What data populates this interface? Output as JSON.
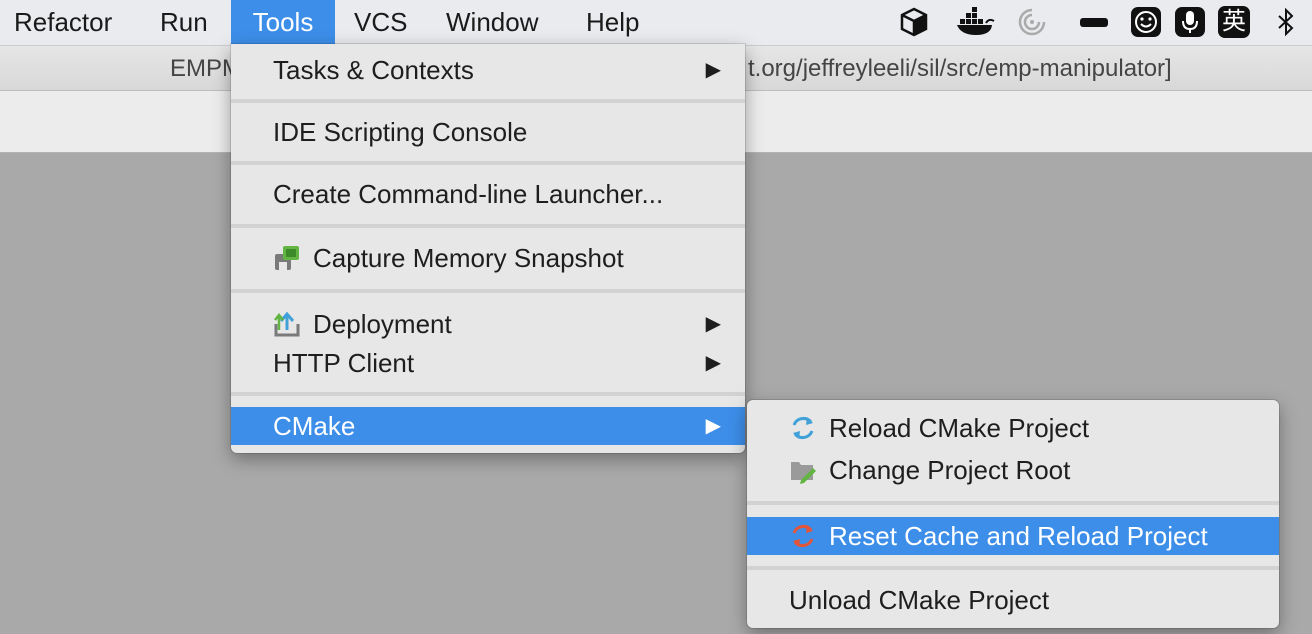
{
  "menubar": {
    "items": [
      {
        "label": "Refactor"
      },
      {
        "label": "Run"
      },
      {
        "label": "Tools"
      },
      {
        "label": "VCS"
      },
      {
        "label": "Window"
      },
      {
        "label": "Help"
      }
    ],
    "tray_icons": [
      "virtualbox-icon",
      "docker-icon",
      "spinner-icon",
      "battery-icon",
      "smiley-icon",
      "microphone-icon",
      "input-method-icon",
      "bluetooth-icon"
    ],
    "input_method_label": "英"
  },
  "titlebar": {
    "left_text": "EMPM",
    "right_text": "t.org/jeffreyleeli/sil/src/emp-manipulator]"
  },
  "tools_menu": {
    "items": [
      {
        "label": "Tasks & Contexts",
        "submenu": true
      },
      {
        "label": "IDE Scripting Console"
      },
      {
        "label": "Create Command-line Launcher..."
      },
      {
        "label": "Capture Memory Snapshot",
        "icon": "memory-snapshot-icon"
      },
      {
        "label": "Deployment",
        "icon": "deployment-icon",
        "submenu": true
      },
      {
        "label": "HTTP Client",
        "submenu": true
      },
      {
        "label": "CMake",
        "submenu": true,
        "highlighted": true
      }
    ],
    "arrow": "▶"
  },
  "cmake_menu": {
    "items": [
      {
        "label": "Reload CMake Project",
        "icon": "reload-icon"
      },
      {
        "label": "Change Project Root",
        "icon": "folder-edit-icon"
      },
      {
        "label": "Reset Cache and Reload Project",
        "icon": "reset-reload-icon",
        "highlighted": true
      },
      {
        "label": "Unload CMake Project"
      }
    ]
  },
  "colors": {
    "highlight": "#3d8ee9",
    "menu_bg": "#e7e7e7",
    "workspace_bg": "#a9a9a9"
  }
}
